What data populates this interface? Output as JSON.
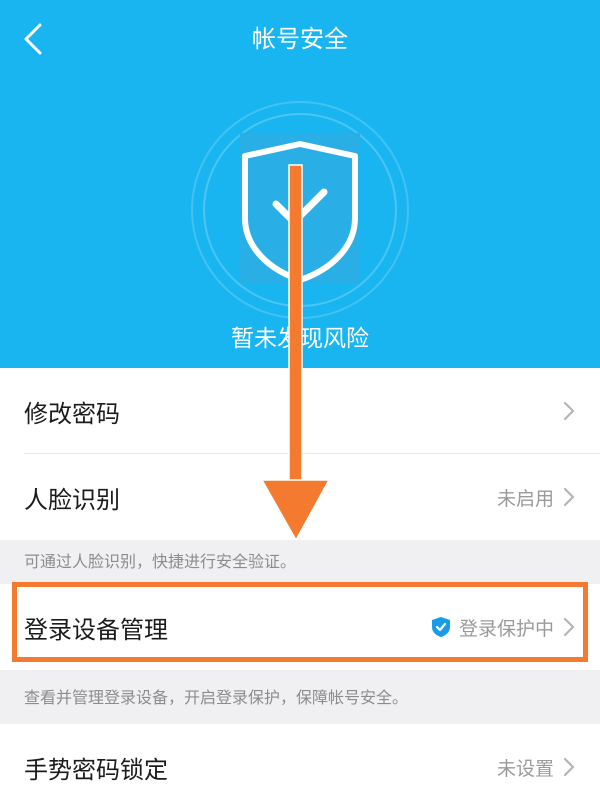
{
  "header": {
    "title": "帐号安全",
    "status": "暂未发现风险",
    "color": "#19b5f0"
  },
  "items": [
    {
      "label": "修改密码",
      "value": ""
    },
    {
      "label": "人脸识别",
      "value": "未启用"
    },
    {
      "label": "登录设备管理",
      "value": "登录保护中"
    },
    {
      "label": "手势密码锁定",
      "value": "未设置"
    }
  ],
  "notes": {
    "face": "可通过人脸识别，快捷进行安全验证。",
    "device": "查看并管理登录设备，开启登录保护，保障帐号安全。"
  },
  "annotation": {
    "color": "#f37a2e"
  },
  "icons": {
    "back": "chevron-left-icon",
    "shield": "shield-check-icon",
    "chevron": "chevron-right-icon"
  }
}
